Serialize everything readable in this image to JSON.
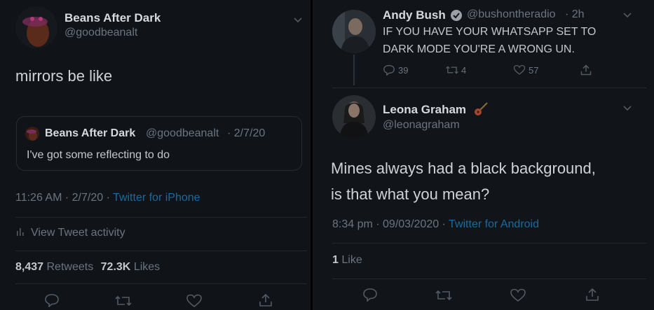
{
  "left_tweet": {
    "author_name": "Beans After Dark",
    "author_handle": "@goodbeanalt",
    "text": "mirrors be like",
    "quoted": {
      "author_name": "Beans After Dark",
      "author_handle": "@goodbeanalt",
      "date": "· 2/7/20",
      "text": "I've got some reflecting to do"
    },
    "timestamp": "11:26 AM · 2/7/20 · ",
    "source": "Twitter for iPhone",
    "activity_label": "View Tweet activity",
    "retweets_count": "8,437",
    "retweets_label": "Retweets",
    "likes_count": "72.3K",
    "likes_label": "Likes"
  },
  "right_top_tweet": {
    "author_name": "Andy Bush",
    "author_handle": "@bushontheradio",
    "age": "· 2h",
    "text_line1": "IF YOU HAVE YOUR WHATSAPP SET TO",
    "text_line2": "DARK MODE YOU'RE A WRONG UN.",
    "replies": "39",
    "retweets": "4",
    "likes": "57"
  },
  "right_reply_tweet": {
    "author_name": "Leona Graham",
    "author_handle": "@leonagraham",
    "text_line1": "Mines always had a black background,",
    "text_line2": "is that what you mean?",
    "timestamp": "8:34 pm · 09/03/2020 · ",
    "source": "Twitter for Android",
    "like_count": "1",
    "like_label": "Like"
  },
  "colors": {
    "background": "#101317",
    "link": "#1c6a9c",
    "muted": "#6b7580",
    "text": "#cfd3d8"
  },
  "icons": [
    "reply-icon",
    "retweet-icon",
    "like-icon",
    "share-icon",
    "chevron-down-icon",
    "verified-icon",
    "bar-chart-icon",
    "guitar-emoji-icon"
  ]
}
